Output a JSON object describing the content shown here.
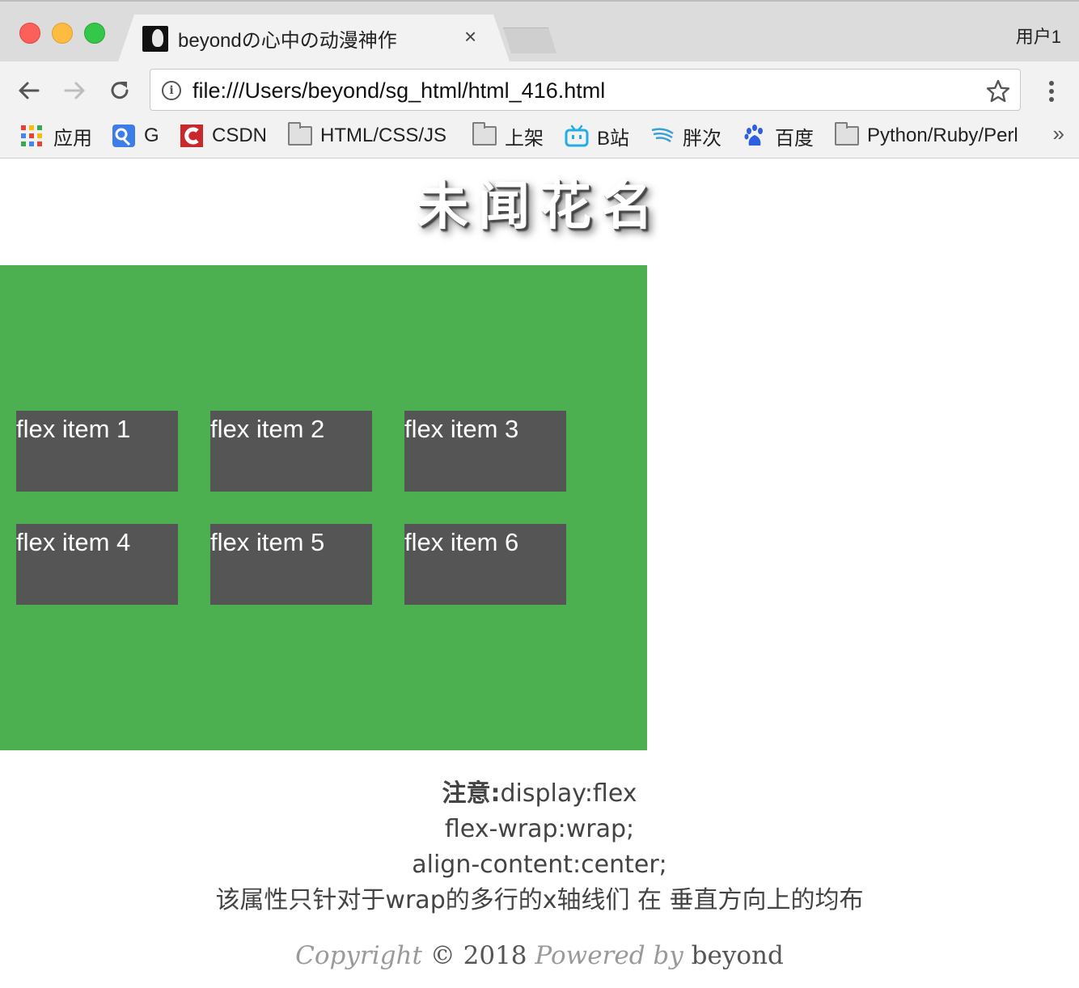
{
  "window": {
    "tab_title": "beyondの心中の动漫神作",
    "tab_close": "×",
    "user": "用户1"
  },
  "toolbar": {
    "url": "file:///Users/beyond/sg_html/html_416.html",
    "info_glyph": "i"
  },
  "bookmarks": [
    {
      "label": "应用",
      "icon": "apps-grid-icon"
    },
    {
      "label": "G",
      "icon": "google-icon"
    },
    {
      "label": "CSDN",
      "icon": "csdn-icon"
    },
    {
      "label": "HTML/CSS/JS",
      "icon": "folder-icon"
    },
    {
      "label": "上架",
      "icon": "folder-icon"
    },
    {
      "label": "B站",
      "icon": "bilibili-icon"
    },
    {
      "label": "胖次",
      "icon": "wing-icon"
    },
    {
      "label": "百度",
      "icon": "baidu-paw-icon"
    },
    {
      "label": "Python/Ruby/Perl",
      "icon": "folder-icon"
    }
  ],
  "bookmarks_more": "»",
  "page": {
    "title": "未闻花名",
    "flex_items": [
      "flex item 1",
      "flex item 2",
      "flex item 3",
      "flex item 4",
      "flex item 5",
      "flex item 6"
    ],
    "note_label": "注意:",
    "note_line1": "display:flex",
    "note_line2": "flex-wrap:wrap;",
    "note_line3": "align-content:center;",
    "note_line4": "该属性只针对于wrap的多行的x轴线们 在 垂直方向上的均布",
    "footer": {
      "copyright": "Copyright",
      "symbol_year": "© 2018",
      "powered_by": "Powered by",
      "author": "beyond"
    }
  },
  "colors": {
    "container": "#4caf50",
    "item": "#555555"
  }
}
